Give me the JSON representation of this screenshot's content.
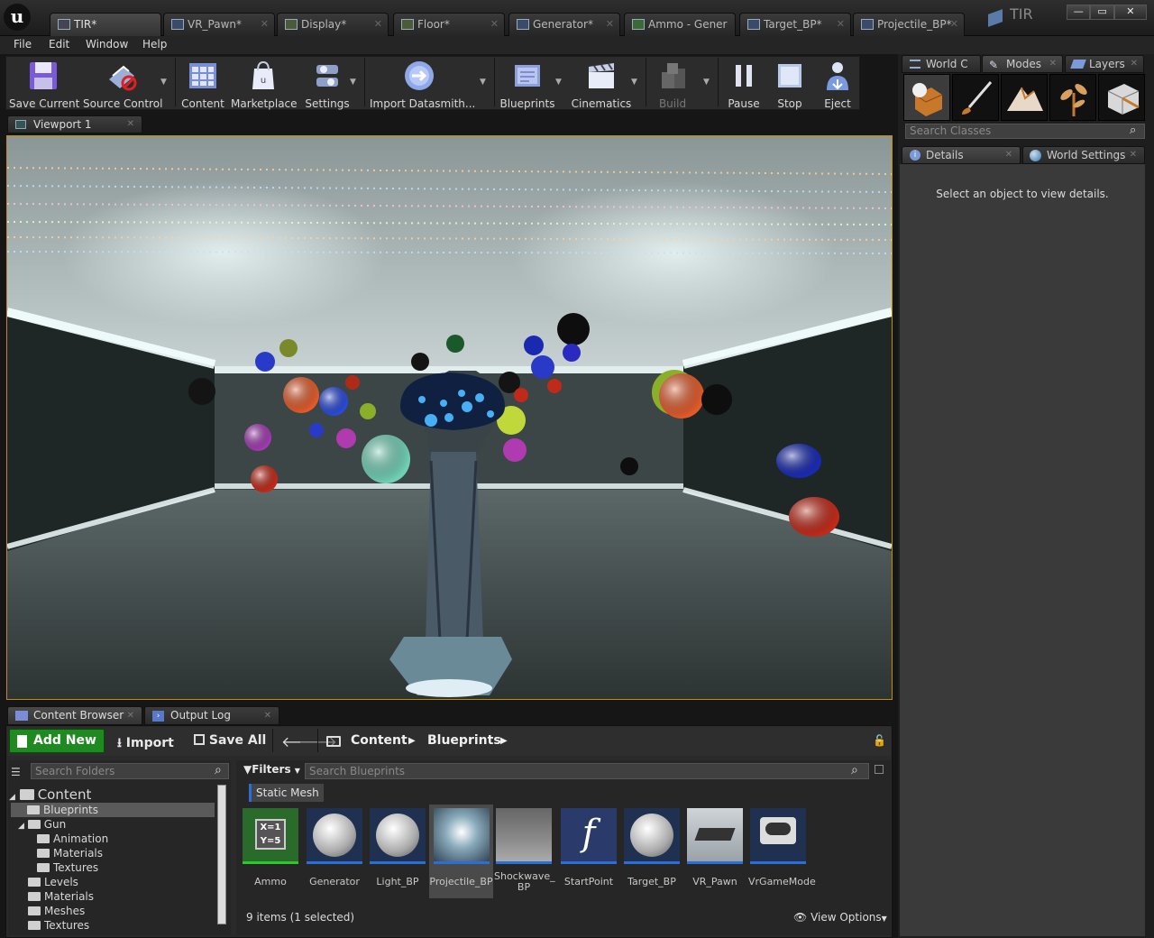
{
  "title_tabs": [
    {
      "label": "TIR*",
      "active": true
    },
    {
      "label": "VR_Pawn*",
      "active": false
    },
    {
      "label": "Display*",
      "active": false
    },
    {
      "label": "Floor*",
      "active": false
    },
    {
      "label": "Generator*",
      "active": false
    },
    {
      "label": "Ammo - Gener",
      "active": false
    },
    {
      "label": "Target_BP*",
      "active": false
    },
    {
      "label": "Projectile_BP*",
      "active": false
    }
  ],
  "project_name": "TIR",
  "menu": [
    "File",
    "Edit",
    "Window",
    "Help"
  ],
  "toolbar": [
    {
      "label": "Save Current",
      "icon": "save-icon"
    },
    {
      "label": "Source Control",
      "icon": "source-control-icon"
    },
    {
      "label": "Content",
      "icon": "content-icon"
    },
    {
      "label": "Marketplace",
      "icon": "marketplace-icon"
    },
    {
      "label": "Settings",
      "icon": "settings-icon"
    },
    {
      "label": "Import Datasmith...",
      "icon": "datasmith-icon"
    },
    {
      "label": "Blueprints",
      "icon": "blueprints-icon"
    },
    {
      "label": "Cinematics",
      "icon": "cinematics-icon"
    },
    {
      "label": "Build",
      "icon": "build-icon",
      "disabled": true
    },
    {
      "label": "Pause",
      "icon": "pause-icon"
    },
    {
      "label": "Stop",
      "icon": "stop-icon"
    },
    {
      "label": "Eject",
      "icon": "eject-icon"
    }
  ],
  "viewport_tab": "Viewport 1",
  "right_tabs": [
    "World C",
    "Modes",
    "Layers"
  ],
  "search_classes_placeholder": "Search Classes",
  "details_tabs": [
    "Details",
    "World Settings"
  ],
  "details_message": "Select an object to view details.",
  "bottom_tabs": [
    "Content Browser",
    "Output Log"
  ],
  "cb": {
    "add_new": "Add New",
    "import": "Import",
    "save_all": "Save All",
    "breadcrumb": [
      "Content",
      "Blueprints"
    ],
    "search_folders_placeholder": "Search Folders",
    "filters": "Filters",
    "search_blueprints_placeholder": "Search Blueprints",
    "filter_chip": "Static Mesh",
    "tree": [
      {
        "label": "Content",
        "depth": 0,
        "root": true
      },
      {
        "label": "Blueprints",
        "depth": 1,
        "selected": true
      },
      {
        "label": "Gun",
        "depth": 1
      },
      {
        "label": "Animation",
        "depth": 2
      },
      {
        "label": "Materials",
        "depth": 2
      },
      {
        "label": "Textures",
        "depth": 2
      },
      {
        "label": "Levels",
        "depth": 1
      },
      {
        "label": "Materials",
        "depth": 1
      },
      {
        "label": "Meshes",
        "depth": 1
      },
      {
        "label": "Textures",
        "depth": 1
      }
    ],
    "assets": [
      {
        "label": "Ammo"
      },
      {
        "label": "Generator"
      },
      {
        "label": "Light_BP"
      },
      {
        "label": "Projectile_BP",
        "selected": true
      },
      {
        "label": "Shockwave_ BP"
      },
      {
        "label": "StartPoint"
      },
      {
        "label": "Target_BP"
      },
      {
        "label": "VR_Pawn"
      },
      {
        "label": "VrGameMode"
      }
    ],
    "item_count": "9 items (1 selected)",
    "view_options": "View Options"
  },
  "colors": {
    "accent_green": "#1f8a1f",
    "viewport_border": "#c28b0c",
    "asset_underline": "#2a6fd8"
  }
}
